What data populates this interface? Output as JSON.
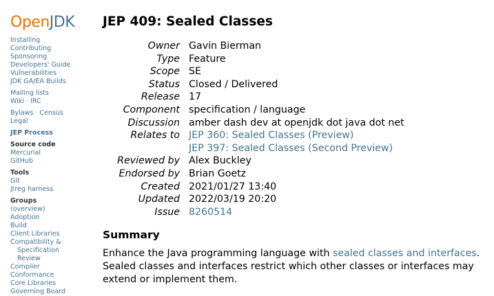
{
  "logo": {
    "open": "Open",
    "jdk": "JDK"
  },
  "sidebar": {
    "group1": [
      "Installing",
      "Contributing",
      "Sponsoring",
      "Developers' Guide",
      "Vulnerabilities",
      "JDK GA/EA Builds"
    ],
    "mailing_lists": "Mailing lists",
    "wiki": "Wiki",
    "wiki_sep": " · ",
    "irc": "IRC",
    "bylaws": "Bylaws",
    "bylaws_sep": " · ",
    "census": "Census",
    "legal": "Legal",
    "jep_process": "JEP Process",
    "source_code": "Source code",
    "mercurial": "Mercurial",
    "github": "GitHub",
    "tools": "Tools",
    "git": "Git",
    "jtreg": "jtreg harness",
    "groups": "Groups",
    "group_items": [
      "(overview)",
      "Adoption",
      "Build",
      "Client Libraries",
      "Compatibility &",
      "Specification",
      "Review",
      "Compiler",
      "Conformance",
      "Core Libraries",
      "Governing Board"
    ]
  },
  "page": {
    "title": "JEP 409: Sealed Classes",
    "meta": {
      "owner_k": "Owner",
      "owner_v": "Gavin Bierman",
      "type_k": "Type",
      "type_v": "Feature",
      "scope_k": "Scope",
      "scope_v": "SE",
      "status_k": "Status",
      "status_v": "Closed / Delivered",
      "release_k": "Release",
      "release_v": "17",
      "component_k": "Component",
      "component_v": "specification / language",
      "discussion_k": "Discussion",
      "discussion_v": "amber dash dev at openjdk dot java dot net",
      "relates_k": "Relates to",
      "relates_1": "JEP 360: Sealed Classes (Preview)",
      "relates_2": "JEP 397: Sealed Classes (Second Preview)",
      "reviewed_k": "Reviewed by",
      "reviewed_v": "Alex Buckley",
      "endorsed_k": "Endorsed by",
      "endorsed_v": "Brian Goetz",
      "created_k": "Created",
      "created_v": "2021/01/27 13:40",
      "updated_k": "Updated",
      "updated_v": "2022/03/19 20:20",
      "issue_k": "Issue",
      "issue_v": "8260514"
    },
    "summary_heading": "Summary",
    "summary_pre": "Enhance the Java programming language with ",
    "summary_link": "sealed classes and interfaces",
    "summary_post": ". Sealed classes and interfaces restrict which other classes or interfaces may extend or implement them."
  }
}
